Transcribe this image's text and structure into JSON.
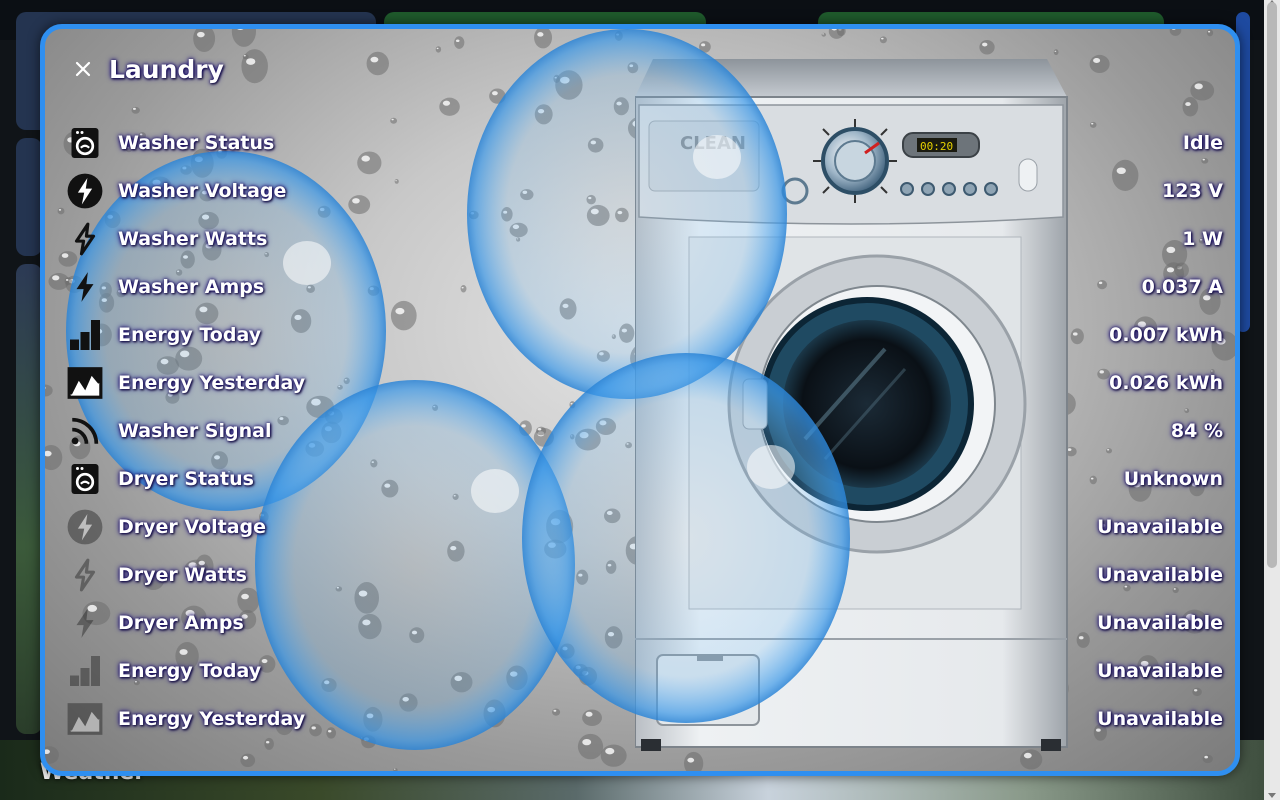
{
  "background": {
    "section_title": "Weather"
  },
  "dialog": {
    "title": "Laundry",
    "close_icon": "close-icon",
    "accent_color": "#2f8ff0"
  },
  "entities": [
    {
      "icon": "washing-machine-icon",
      "label": "Washer Status",
      "value": "Idle",
      "available": true
    },
    {
      "icon": "flash-circle-icon",
      "label": "Washer Voltage",
      "value": "123 V",
      "available": true
    },
    {
      "icon": "flash-outline-icon",
      "label": "Washer Watts",
      "value": "1 W",
      "available": true
    },
    {
      "icon": "flash-icon",
      "label": "Washer Amps",
      "value": "0.037 A",
      "available": true
    },
    {
      "icon": "bar-chart-icon",
      "label": "Energy Today",
      "value": "0.007 kWh",
      "available": true
    },
    {
      "icon": "chart-areaspline-icon",
      "label": "Energy Yesterday",
      "value": "0.026 kWh",
      "available": true
    },
    {
      "icon": "wifi-signal-icon",
      "label": "Washer Signal",
      "value": "84 %",
      "available": true
    },
    {
      "icon": "tumble-dryer-icon",
      "label": "Dryer Status",
      "value": "Unknown",
      "available": true
    },
    {
      "icon": "flash-circle-icon",
      "label": "Dryer Voltage",
      "value": "Unavailable",
      "available": false
    },
    {
      "icon": "flash-outline-icon",
      "label": "Dryer Watts",
      "value": "Unavailable",
      "available": false
    },
    {
      "icon": "flash-icon",
      "label": "Dryer Amps",
      "value": "Unavailable",
      "available": false
    },
    {
      "icon": "bar-chart-icon",
      "label": "Energy Today",
      "value": "Unavailable",
      "available": false
    },
    {
      "icon": "chart-areaspline-icon",
      "label": "Energy Yesterday",
      "value": "Unavailable",
      "available": false
    }
  ],
  "washer_art": {
    "display_text": "00:20",
    "door_text": "CLEAN"
  }
}
